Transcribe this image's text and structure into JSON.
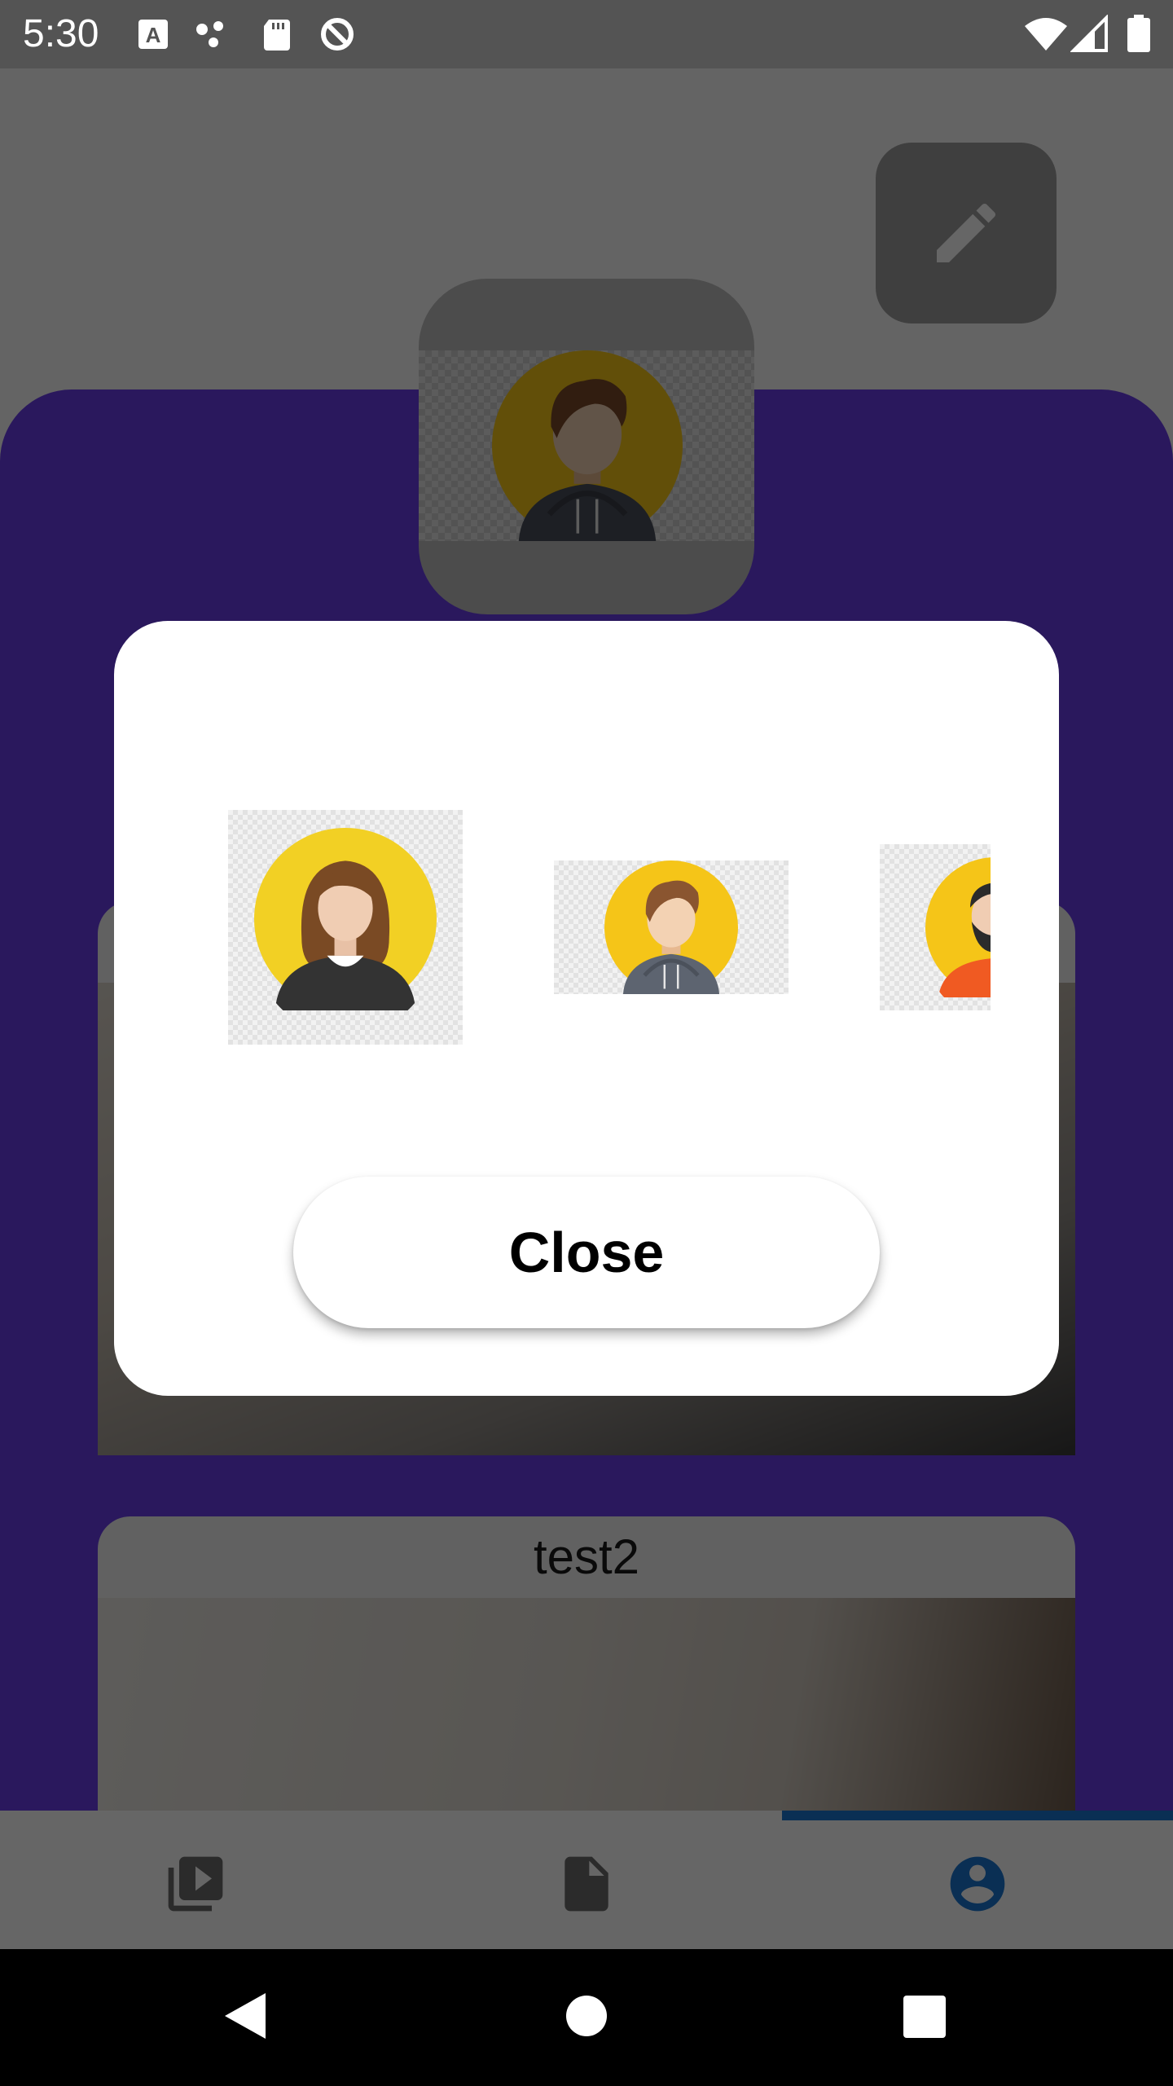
{
  "status_bar": {
    "time": "5:30",
    "left_icons": [
      "text-a-icon",
      "dots-icon",
      "sd-card-icon",
      "data-saver-icon"
    ],
    "right_icons": [
      "wifi-icon",
      "signal-icon",
      "battery-icon"
    ]
  },
  "background": {
    "edit_icon": "pencil-icon",
    "cards": [
      {
        "title": ""
      },
      {
        "title": "test2"
      }
    ]
  },
  "bottom_nav": {
    "items": [
      {
        "icon": "video-library-icon",
        "active": false
      },
      {
        "icon": "document-icon",
        "active": false
      },
      {
        "icon": "account-circle-icon",
        "active": true
      }
    ],
    "active_color": "#1976d2"
  },
  "dialog": {
    "avatar_options": [
      "woman-avatar",
      "man-hoodie-avatar",
      "bearded-man-avatar"
    ],
    "close_label": "Close"
  },
  "colors": {
    "purple": "#6a3de8",
    "avatar_yellow": "#f5c518"
  }
}
